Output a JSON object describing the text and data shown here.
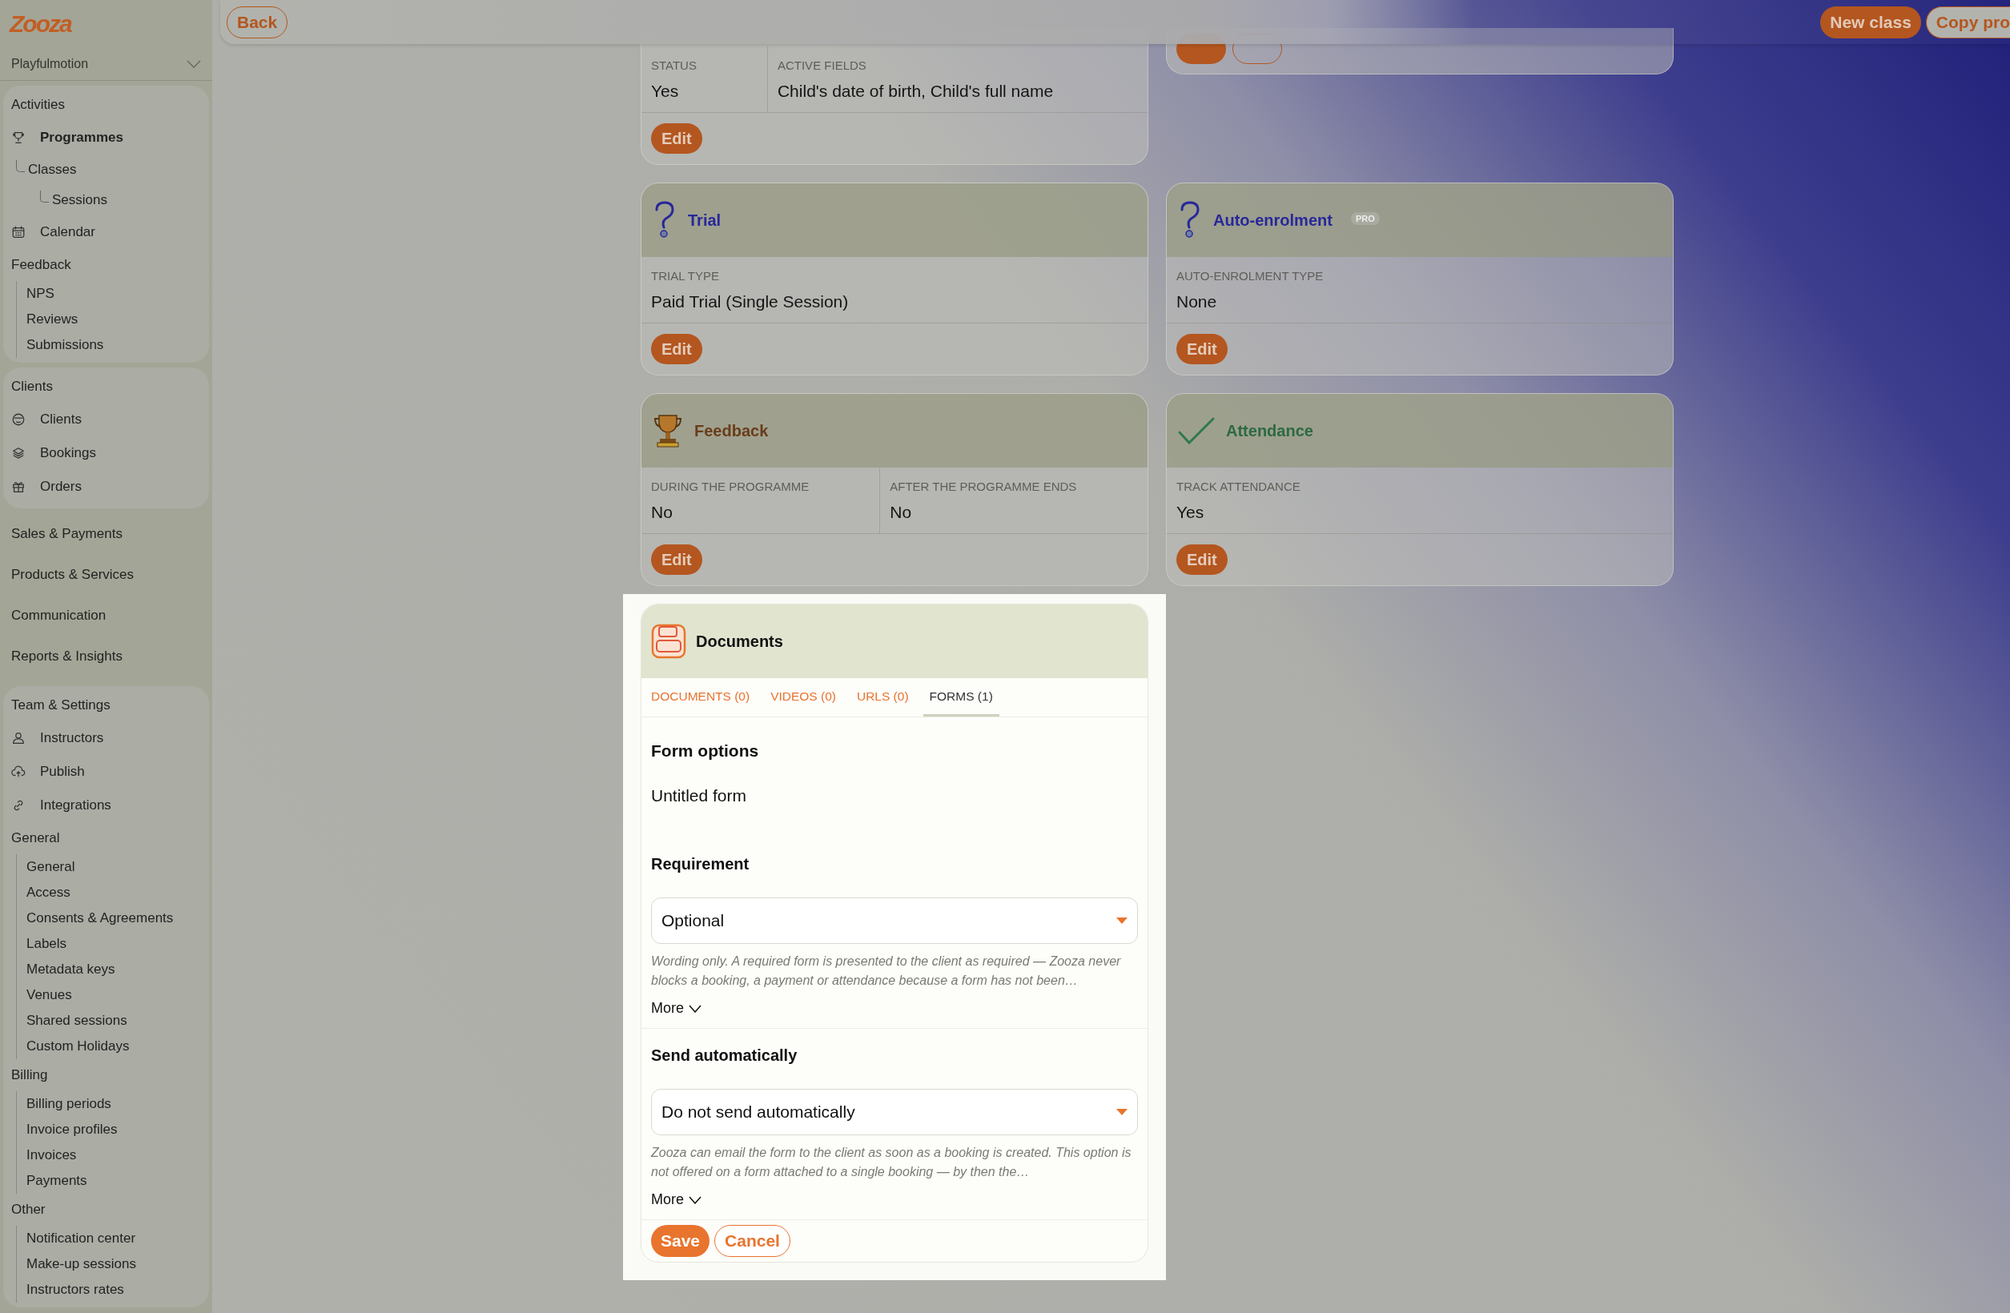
{
  "brand": {
    "logo": "Zooza"
  },
  "sidebar": {
    "organization": "Playfulmotion",
    "groups": [
      {
        "boxed": true,
        "items": [
          {
            "kind": "heading",
            "label": "Activities"
          },
          {
            "kind": "link",
            "label": "Programmes",
            "selected": true,
            "children": [
              {
                "label": "Classes",
                "selected": false,
                "children": [
                  {
                    "label": "Sessions",
                    "selected": false
                  }
                ]
              }
            ]
          },
          {
            "kind": "link",
            "label": "Calendar",
            "selected": false
          },
          {
            "kind": "heading",
            "label": "Feedback",
            "children": [
              {
                "label": "NPS",
                "selected": false
              },
              {
                "label": "Reviews",
                "selected": false
              },
              {
                "label": "Submissions",
                "selected": false
              }
            ]
          }
        ]
      },
      {
        "boxed": true,
        "items": [
          {
            "kind": "heading",
            "label": "Clients"
          },
          {
            "kind": "link",
            "label": "Clients",
            "selected": false
          },
          {
            "kind": "link",
            "label": "Bookings",
            "selected": false
          },
          {
            "kind": "link",
            "label": "Orders",
            "selected": false
          }
        ]
      },
      {
        "boxed": false,
        "items": [
          {
            "kind": "heading",
            "label": "Sales & Payments"
          },
          {
            "kind": "heading",
            "label": "Products & Services"
          },
          {
            "kind": "heading",
            "label": "Communication"
          },
          {
            "kind": "heading",
            "label": "Reports & Insights"
          }
        ]
      },
      {
        "boxed": true,
        "items": [
          {
            "kind": "heading",
            "label": "Team & Settings"
          },
          {
            "kind": "link",
            "label": "Instructors",
            "selected": false
          },
          {
            "kind": "link",
            "label": "Publish",
            "selected": false
          },
          {
            "kind": "link",
            "label": "Integrations",
            "selected": false
          },
          {
            "kind": "heading",
            "label": "General",
            "children": [
              {
                "label": "General",
                "selected": false
              },
              {
                "label": "Access",
                "selected": false
              },
              {
                "label": "Consents & Agreements",
                "selected": false
              },
              {
                "label": "Labels",
                "selected": false
              },
              {
                "label": "Metadata keys",
                "selected": false
              },
              {
                "label": "Venues",
                "selected": false
              },
              {
                "label": "Shared sessions",
                "selected": false
              },
              {
                "label": "Custom Holidays",
                "selected": false
              }
            ]
          },
          {
            "kind": "heading",
            "label": "Billing",
            "children": [
              {
                "label": "Billing periods",
                "selected": false
              },
              {
                "label": "Invoice profiles",
                "selected": false
              },
              {
                "label": "Invoices",
                "selected": false
              },
              {
                "label": "Payments",
                "selected": false
              }
            ]
          },
          {
            "kind": "heading",
            "label": "Other",
            "children": [
              {
                "label": "Notification center",
                "selected": false
              },
              {
                "label": "Make-up sessions",
                "selected": false
              },
              {
                "label": "Instructors rates",
                "selected": false
              }
            ]
          }
        ]
      }
    ]
  },
  "topbar": {
    "back": "Back",
    "actions": [
      {
        "label": "New class",
        "kind": "primary"
      },
      {
        "label": "Copy pro",
        "kind": "secondary"
      }
    ]
  },
  "top_left_card": {
    "fields": [
      {
        "label": "STATUS",
        "value": "Yes"
      },
      {
        "label": "ACTIVE FIELDS",
        "value": "Child's date of birth, Child's full name"
      }
    ],
    "buttons": [
      {
        "label": "Edit",
        "kind": "primary"
      }
    ]
  },
  "top_right_card": {
    "buttons": [
      {
        "kind": "primary"
      },
      {
        "kind": "secondary"
      }
    ]
  },
  "cards": [
    {
      "kind": "full",
      "title": "Trial",
      "color": "#28289a",
      "fields": [
        {
          "label": "TRIAL TYPE",
          "value": "Paid Trial (Single Session)"
        }
      ],
      "buttons": [
        {
          "label": "Edit",
          "kind": "primary"
        }
      ]
    },
    {
      "kind": "full",
      "title": "Auto-enrolment",
      "color": "#28289a",
      "badge": "PRO",
      "fields": [
        {
          "label": "AUTO-ENROLMENT TYPE",
          "value": "None"
        }
      ],
      "buttons": [
        {
          "label": "Edit",
          "kind": "primary"
        }
      ]
    },
    {
      "kind": "full",
      "title": "Feedback",
      "color": "#6a3c1a",
      "fields": [
        {
          "label": "DURING THE PROGRAMME",
          "value": "No"
        },
        {
          "label": "AFTER THE PROGRAMME ENDS",
          "value": "No"
        }
      ],
      "buttons": [
        {
          "label": "Edit",
          "kind": "primary"
        }
      ]
    },
    {
      "kind": "full",
      "title": "Attendance",
      "color": "#2c6a42",
      "fields": [
        {
          "label": "TRACK ATTENDANCE",
          "value": "Yes"
        }
      ],
      "buttons": [
        {
          "label": "Edit",
          "kind": "primary"
        }
      ]
    }
  ],
  "documents": {
    "title": "Documents",
    "tabs": [
      {
        "label": "DOCUMENTS (0)",
        "selected": false
      },
      {
        "label": "VIDEOS (0)",
        "selected": false
      },
      {
        "label": "URLS (0)",
        "selected": false
      },
      {
        "label": "FORMS (1)",
        "selected": true
      }
    ],
    "heading": "Form options",
    "form_name": "Untitled form",
    "settings": [
      {
        "label": "Requirement",
        "value": "Optional",
        "hint": "Wording only. A required form is presented to the client as required — Zooza never blocks a booking, a payment or attendance because a form has not been…",
        "more": "More"
      },
      {
        "label": "Send automatically",
        "value": "Do not send automatically",
        "hint": "Zooza can email the form to the client as soon as a booking is created. This option is not offered on a form attached to a single booking — by then the…",
        "more": "More"
      }
    ],
    "buttons": [
      {
        "label": "Save",
        "kind": "primary"
      },
      {
        "label": "Cancel",
        "kind": "secondary"
      }
    ]
  }
}
